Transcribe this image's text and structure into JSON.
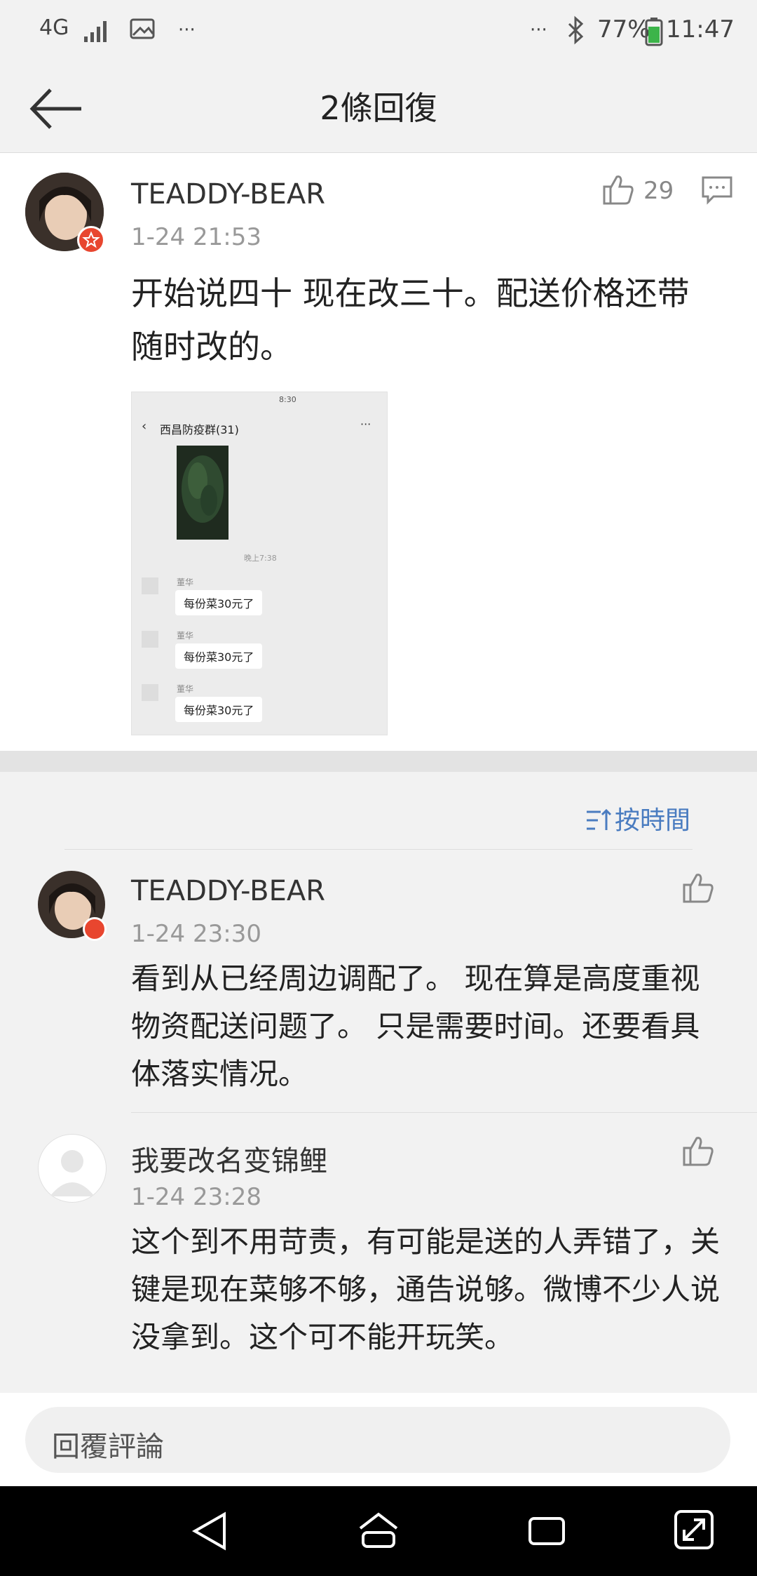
{
  "status_bar": {
    "network": "4G",
    "battery": "77%",
    "time": "11:47",
    "more_dots": "···"
  },
  "header": {
    "title": "2條回復"
  },
  "main_comment": {
    "user": "TEADDY-BEAR",
    "time": "1-24 21:53",
    "likes": "29",
    "content_line1": "开始说四十 现在改三十。配送价格还带",
    "content_line2": "随时改的。",
    "screenshot": {
      "status_time": "8:30",
      "chat_title": "西昌防疫群(31)",
      "time_label": "晚上7:38",
      "messages": [
        {
          "sender": "董华",
          "text": "每份菜30元了"
        },
        {
          "sender": "董华",
          "text": "每份菜30元了"
        },
        {
          "sender": "董华",
          "text": "每份菜30元了"
        }
      ]
    }
  },
  "sort": {
    "label": "按時間"
  },
  "replies": [
    {
      "user": "TEADDY-BEAR",
      "time": "1-24 23:30",
      "lines": [
        "看到从已经周边调配了。 现在算是高度重视",
        "物资配送问题了。 只是需要时间。还要看具",
        "体落实情况。"
      ]
    },
    {
      "user": "我要改名变锦鲤",
      "time": "1-24 23:28",
      "lines": [
        "这个到不用苛责，有可能是送的人弄错了，关",
        "键是现在菜够不够，通告说够。微博不少人说",
        "没拿到。这个可不能开玩笑。"
      ]
    }
  ],
  "input": {
    "placeholder": "回覆評論"
  },
  "colors": {
    "accent": "#4a7cc0",
    "badge": "#e8462f"
  }
}
